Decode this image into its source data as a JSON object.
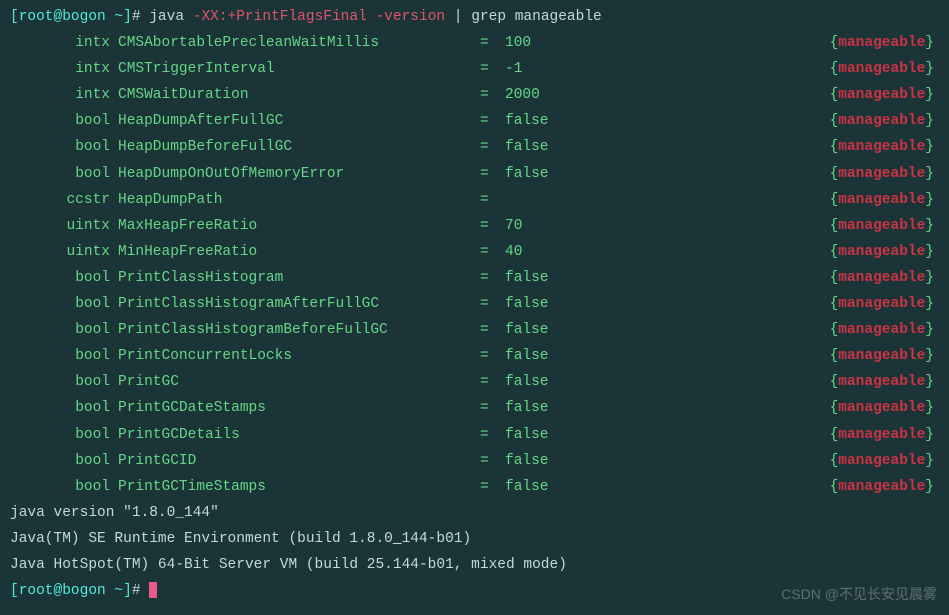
{
  "prompt": {
    "open_bracket": "[",
    "user_host": "root@bogon",
    "path": " ~",
    "close_bracket": "]",
    "hash": "# "
  },
  "command": {
    "base": "java ",
    "flag1": "-XX:+PrintFlagsFinal",
    "middle": " ",
    "flag2": "-version",
    "pipe": " | grep manageable"
  },
  "flags": [
    {
      "type": "intx",
      "name": "CMSAbortablePrecleanWaitMillis",
      "eq": "=",
      "value": "100",
      "cat": "manageable"
    },
    {
      "type": "intx",
      "name": "CMSTriggerInterval",
      "eq": "=",
      "value": "-1",
      "cat": "manageable"
    },
    {
      "type": "intx",
      "name": "CMSWaitDuration",
      "eq": "=",
      "value": "2000",
      "cat": "manageable"
    },
    {
      "type": "bool",
      "name": "HeapDumpAfterFullGC",
      "eq": "=",
      "value": "false",
      "cat": "manageable"
    },
    {
      "type": "bool",
      "name": "HeapDumpBeforeFullGC",
      "eq": "=",
      "value": "false",
      "cat": "manageable"
    },
    {
      "type": "bool",
      "name": "HeapDumpOnOutOfMemoryError",
      "eq": "=",
      "value": "false",
      "cat": "manageable"
    },
    {
      "type": "ccstr",
      "name": "HeapDumpPath",
      "eq": "=",
      "value": "",
      "cat": "manageable"
    },
    {
      "type": "uintx",
      "name": "MaxHeapFreeRatio",
      "eq": "=",
      "value": "70",
      "cat": "manageable"
    },
    {
      "type": "uintx",
      "name": "MinHeapFreeRatio",
      "eq": "=",
      "value": "40",
      "cat": "manageable"
    },
    {
      "type": "bool",
      "name": "PrintClassHistogram",
      "eq": "=",
      "value": "false",
      "cat": "manageable"
    },
    {
      "type": "bool",
      "name": "PrintClassHistogramAfterFullGC",
      "eq": "=",
      "value": "false",
      "cat": "manageable"
    },
    {
      "type": "bool",
      "name": "PrintClassHistogramBeforeFullGC",
      "eq": "=",
      "value": "false",
      "cat": "manageable"
    },
    {
      "type": "bool",
      "name": "PrintConcurrentLocks",
      "eq": "=",
      "value": "false",
      "cat": "manageable"
    },
    {
      "type": "bool",
      "name": "PrintGC",
      "eq": "=",
      "value": "false",
      "cat": "manageable"
    },
    {
      "type": "bool",
      "name": "PrintGCDateStamps",
      "eq": "=",
      "value": "false",
      "cat": "manageable"
    },
    {
      "type": "bool",
      "name": "PrintGCDetails",
      "eq": "=",
      "value": "false",
      "cat": "manageable"
    },
    {
      "type": "bool",
      "name": "PrintGCID",
      "eq": "=",
      "value": "false",
      "cat": "manageable"
    },
    {
      "type": "bool",
      "name": "PrintGCTimeStamps",
      "eq": "=",
      "value": "false",
      "cat": "manageable"
    }
  ],
  "version": {
    "line1": "java version \"1.8.0_144\"",
    "line2_a": "Java(TM) SE Runtime Environment (build 1.8.0",
    "line2_b": "_",
    "line2_c": "144-b01)",
    "line3": "Java HotSpot(TM) 64-Bit Server VM (build 25.144-b01, mixed mode)"
  },
  "watermark": "CSDN @不见长安见晨雾"
}
